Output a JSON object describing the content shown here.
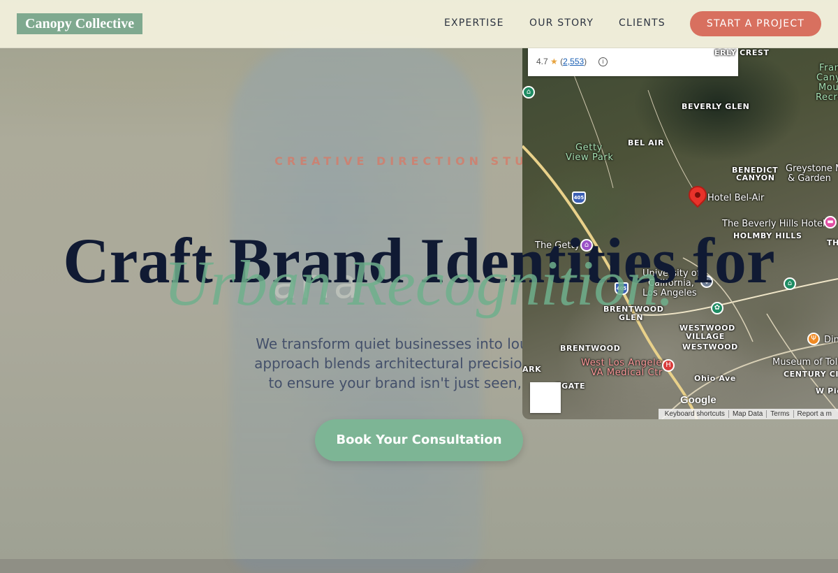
{
  "header": {
    "logo": "Canopy Collective",
    "nav": [
      "EXPERTISE",
      "OUR STORY",
      "CLIENTS"
    ],
    "cta": "START A PROJECT"
  },
  "hero": {
    "eyebrow": "CREATIVE DIRECTION STUDIO",
    "headline": "Craft Brand Identities for",
    "headline_accent": "Urban Recognition.",
    "subtext_lines": [
      "We transform quiet businesses into loud cultur",
      "approach blends architectural precision with ra",
      "to ensure your brand isn't just seen, it is re"
    ],
    "cta": "Book Your Consultation",
    "background_word": "aria"
  },
  "map": {
    "rating": "4.7",
    "review_count": "2,553",
    "labels": {
      "bel_air": "BEL AIR",
      "beverly_glen": "BEVERLY GLEN",
      "beverly_crest": "ERLY CREST",
      "benedict_canyon_1": "BENEDICT",
      "benedict_canyon_2": "CANYON",
      "getty_view_1": "Getty",
      "getty_view_2": "View Park",
      "hotel_bel_air": "Hotel Bel-Air",
      "greystone_1": "Greystone M",
      "greystone_2": "& Garden",
      "franklin_1": "Fran",
      "franklin_2": "Canyo",
      "franklin_3": "Moun",
      "franklin_4": "Recrea",
      "beverly_hills_hotel": "The Beverly Hills Hotel",
      "holmby_hills": "HOLMBY HILLS",
      "the_getty": "The Getty",
      "ucla_1": "University of",
      "ucla_2": "California,",
      "ucla_3": "Los Angeles",
      "brentwood_glen_1": "BRENTWOOD",
      "brentwood_glen_2": "GLEN",
      "westwood_village_1": "WESTWOOD",
      "westwood_village_2": "VILLAGE",
      "westwood": "WESTWOOD",
      "brentwood": "BRENTWOOD",
      "ark": "ARK",
      "va_1": "West Los Angeles",
      "va_2": "VA Medical Ctr",
      "museum_1": "Museum of Tol",
      "museum_2": "CENTURY CITY",
      "dine": "Din",
      "th": "TH",
      "gate": "TGATE",
      "ohio": "Ohio Ave",
      "pico": "W Pico"
    },
    "shield_405": "405",
    "google": "Google",
    "footer": [
      "Keyboard shortcuts",
      "Map Data",
      "Terms",
      "Report a m"
    ]
  }
}
